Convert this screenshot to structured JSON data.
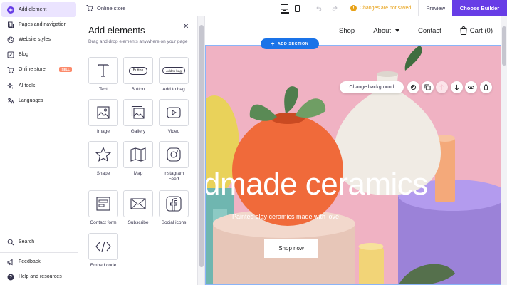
{
  "sidebar": {
    "items": [
      {
        "label": "Add element",
        "icon": "plus-circle-icon",
        "active": true
      },
      {
        "label": "Pages and navigation",
        "icon": "pages-icon"
      },
      {
        "label": "Website styles",
        "icon": "palette-icon"
      },
      {
        "label": "Blog",
        "icon": "blog-icon"
      },
      {
        "label": "Online store",
        "icon": "cart-icon",
        "badge": "SELL"
      },
      {
        "label": "AI tools",
        "icon": "ai-sparkle-icon"
      },
      {
        "label": "Languages",
        "icon": "languages-icon"
      }
    ],
    "bottom": [
      {
        "label": "Search",
        "icon": "search-icon"
      },
      {
        "label": "Feedback",
        "icon": "megaphone-icon"
      },
      {
        "label": "Help and resources",
        "icon": "help-icon"
      }
    ]
  },
  "topbar": {
    "store_tab": "Online store",
    "unsaved": "Changes are not saved",
    "preview": "Preview",
    "choose_builder": "Choose Builder"
  },
  "panel": {
    "title": "Add elements",
    "subtitle": "Drag and drop elements anywhere on your page",
    "tiles": [
      {
        "label": "Text",
        "icon": "text-icon"
      },
      {
        "label": "Button",
        "icon": "button-icon",
        "preview": "Button"
      },
      {
        "label": "Add to bag",
        "icon": "add-to-bag-icon",
        "preview": "Add to bag"
      },
      {
        "label": "Image",
        "icon": "image-icon"
      },
      {
        "label": "Gallery",
        "icon": "gallery-icon"
      },
      {
        "label": "Video",
        "icon": "video-icon"
      },
      {
        "label": "Shape",
        "icon": "star-icon"
      },
      {
        "label": "Map",
        "icon": "map-icon"
      },
      {
        "label": "Instagram Feed",
        "icon": "instagram-icon"
      },
      {
        "label": "Contact form",
        "icon": "form-icon"
      },
      {
        "label": "Subscribe",
        "icon": "envelope-icon"
      },
      {
        "label": "Social icons",
        "icon": "facebook-icon"
      },
      {
        "label": "Embed code",
        "icon": "code-icon"
      }
    ]
  },
  "site": {
    "nav": [
      {
        "label": "Shop"
      },
      {
        "label": "About",
        "dropdown": true
      },
      {
        "label": "Contact"
      }
    ],
    "cart": "Cart (0)",
    "add_section": "ADD SECTION",
    "change_background": "Change background",
    "hero_title": "dmade ceramics",
    "hero_subtitle": "Painted clay ceramics made with love.",
    "cta": "Shop now"
  },
  "colors": {
    "accent": "#673de6",
    "active_bg": "#ebe4ff",
    "warning": "#e8a218",
    "hero_bg": "#f0b2c3",
    "section_blue": "#1a73e8",
    "badge": "#fc8a6b"
  }
}
